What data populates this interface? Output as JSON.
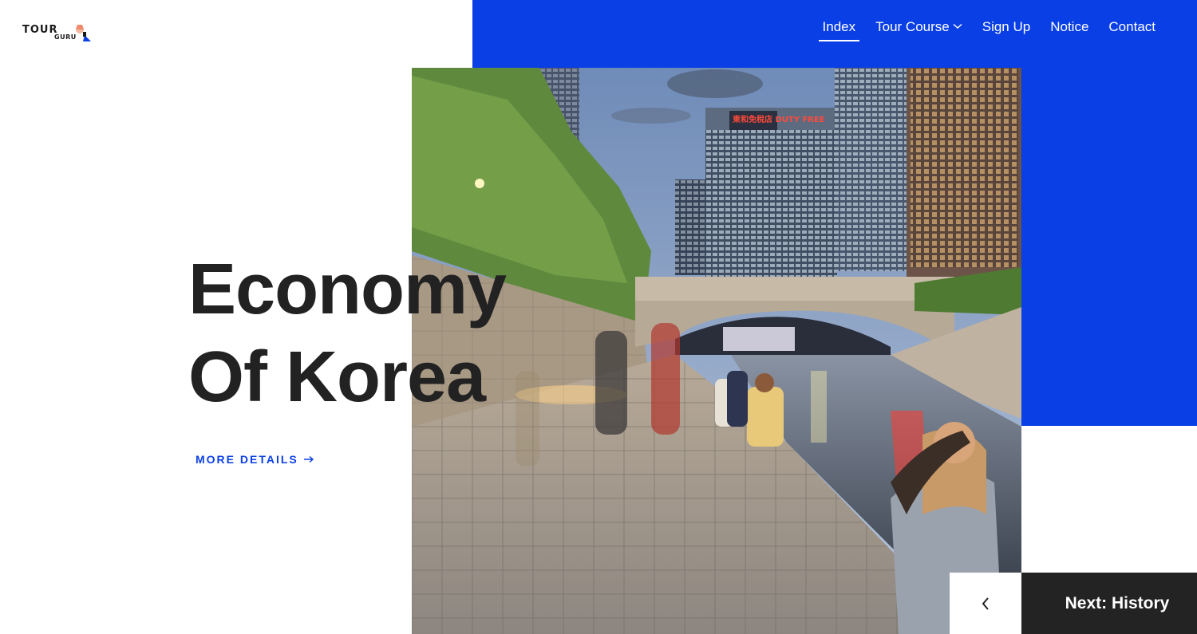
{
  "brand": {
    "line1": "TOUR",
    "line2": "GURU"
  },
  "nav": {
    "items": [
      {
        "label": "Index"
      },
      {
        "label": "Tour Course"
      },
      {
        "label": "Sign Up"
      },
      {
        "label": "Notice"
      },
      {
        "label": "Contact"
      }
    ],
    "active": "Index"
  },
  "hero": {
    "title_line1": "Economy",
    "title_line2": "Of Korea",
    "cta_label": "MORE DETAILS",
    "image_subject": "Cheonggyecheon stream at dusk with city towers and bridge",
    "photo_sign_text": "東和免稅店 DUTY FREE"
  },
  "pager": {
    "prev_icon": "chevron-left-icon",
    "next_label": "Next: History"
  },
  "colors": {
    "accent": "#0a3fe6",
    "dark": "#232323",
    "text": "#222222"
  }
}
